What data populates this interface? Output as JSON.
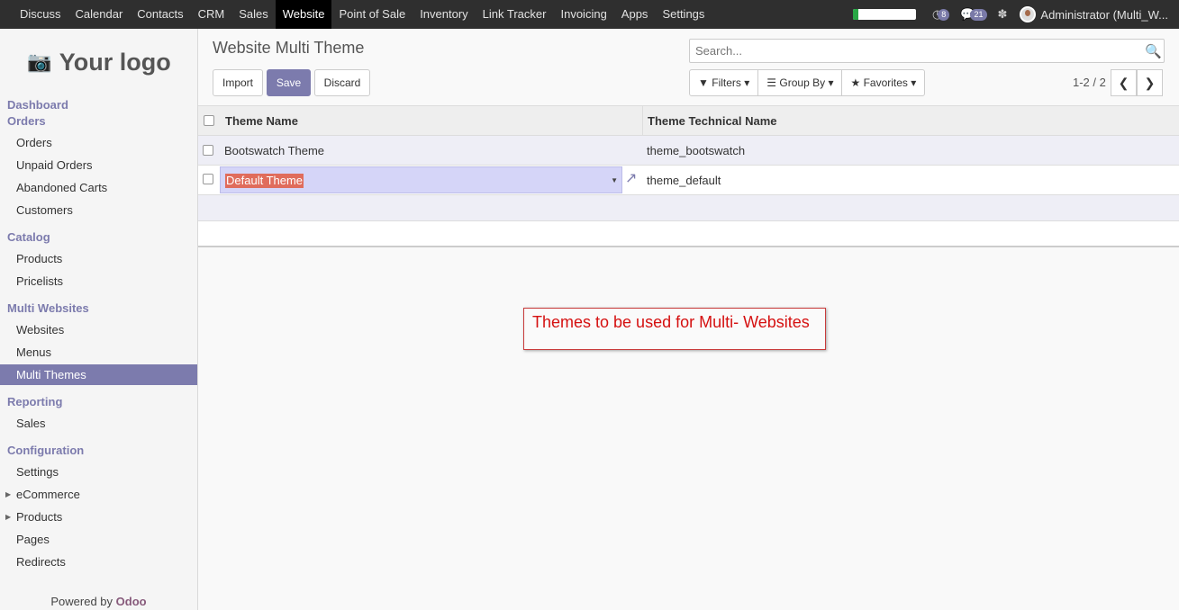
{
  "topbar": {
    "menu": [
      "Discuss",
      "Calendar",
      "Contacts",
      "CRM",
      "Sales",
      "Website",
      "Point of Sale",
      "Inventory",
      "Link Tracker",
      "Invoicing",
      "Apps",
      "Settings"
    ],
    "active": "Website",
    "progress_fraction": 0.08,
    "activity_count": "8",
    "message_count": "21",
    "user": "Administrator (Multi_W..."
  },
  "sidebar": {
    "logo": "Your logo",
    "sections": [
      {
        "title": "Dashboard",
        "items": []
      },
      {
        "title": "Orders",
        "items": [
          "Orders",
          "Unpaid Orders",
          "Abandoned Carts",
          "Customers"
        ]
      },
      {
        "title": "Catalog",
        "items": [
          "Products",
          "Pricelists"
        ]
      },
      {
        "title": "Multi Websites",
        "items": [
          "Websites",
          "Menus",
          "Multi Themes"
        ]
      },
      {
        "title": "Reporting",
        "items": [
          "Sales"
        ]
      },
      {
        "title": "Configuration",
        "items": [
          "Settings",
          "eCommerce",
          "Products",
          "Pages",
          "Redirects"
        ]
      }
    ],
    "active_item": "Multi Themes",
    "powered_prefix": "Powered by ",
    "powered_brand": "Odoo"
  },
  "control": {
    "title": "Website Multi Theme",
    "import_label": "Import",
    "save_label": "Save",
    "discard_label": "Discard",
    "search_placeholder": "Search...",
    "filters_label": "Filters",
    "groupby_label": "Group By",
    "favorites_label": "Favorites",
    "pager": "1-2 / 2"
  },
  "list": {
    "columns": [
      "Theme Name",
      "Theme Technical Name"
    ],
    "rows": [
      {
        "name": "Bootswatch Theme",
        "technical": "theme_bootswatch"
      },
      {
        "name": "Default Theme",
        "technical": "theme_default"
      }
    ]
  },
  "annotation": "Themes to be used for Multi- Websites",
  "colors": {
    "accent": "#7c7bad",
    "annotation": "#d51010",
    "topbar": "#2f2f2f"
  }
}
